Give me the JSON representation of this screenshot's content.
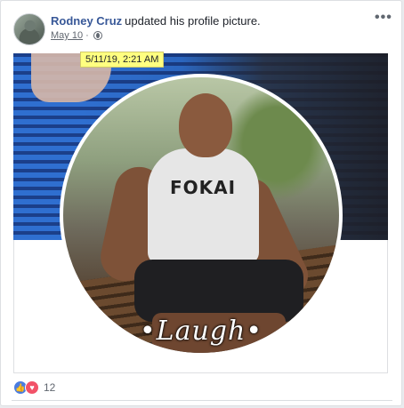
{
  "post": {
    "author": "Rodney Cruz",
    "action": "updated his profile picture.",
    "date": "May 10",
    "privacy_icon": "globe-icon",
    "more_icon": "more-options-icon",
    "more_glyph": "•••",
    "tooltip": "5/11/19, 2:21 AM"
  },
  "photo": {
    "shirt_text": "FOKAI",
    "frame_text": "•Laugh•"
  },
  "reactions": {
    "icons": [
      "like-icon",
      "love-icon"
    ],
    "count": "12"
  }
}
